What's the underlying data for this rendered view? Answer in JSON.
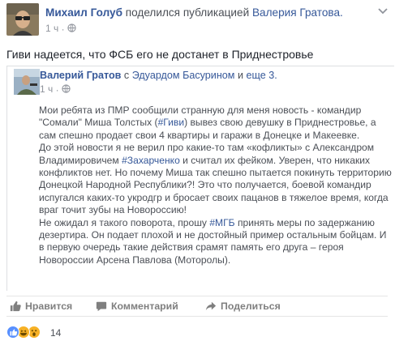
{
  "header": {
    "author": "Михаил Голуб",
    "action": "поделился публикацией",
    "shared_from": "Валерия Гратова.",
    "time": "1 ч",
    "separator": "·"
  },
  "post": {
    "title": "Гиви надеется, что ФСБ его не достанет в Приднестровье"
  },
  "shared": {
    "author": "Валерий Гратов",
    "with_word": "с",
    "tagged": "Эдуардом Басурином",
    "and_word": "и",
    "more": "еще 3.",
    "time": "1 ч",
    "separator": "·",
    "body": {
      "l1": "Мои ребята из ПМР сообщили странную для меня новость - командир",
      "l2a": "\"Сомали\" Миша Толстых (",
      "l2tag": "#Гиви",
      "l2b": ") вывез свою девушку в Приднестровье, а",
      "l3": "сам спешно продает свои 4 квартиры и гаражи в Донецке и Макеевке.",
      "l4": "До этой новости я не верил про какие-то там «кофликты» с Александром",
      "l5a": "Владимировичем ",
      "l5tag": "#Захарченко",
      "l5b": " и считал их фейком. Уверен, что никаких",
      "l6": "конфликтов нет. Но почему Миша так спешно пытается покинуть территорию",
      "l7": "Донецкой Народной Республики?! Это что получается, боевой командир",
      "l8": "испугался каких-то укродгр и бросает своих пацанов в тяжелое время, когда",
      "l9": "враг точит зубы на Новороссию!",
      "l10a": "Не ожидал я такого поворота, прошу ",
      "l10tag": "#МГБ",
      "l10b": " принять меры по задержанию",
      "l11": "дезертира. Он подает плохой и не достойный пример остальным бойцам. И",
      "l12": "в первую очередь такие действия срамят память его друга – героя",
      "l13": "Новороссии Арсена Павлова (Моторолы)."
    }
  },
  "actions": {
    "like": "Нравится",
    "comment": "Комментарий",
    "share": "Поделиться"
  },
  "reactions": {
    "icons": [
      "like-icon",
      "haha-icon",
      "wow-icon"
    ],
    "count": "14",
    "colors": {
      "like": "#5890ff",
      "emoji": "#f7b125"
    }
  },
  "colors": {
    "link": "#365899",
    "text": "#1d2129",
    "secondary": "#4b4f56",
    "muted": "#90949c"
  }
}
